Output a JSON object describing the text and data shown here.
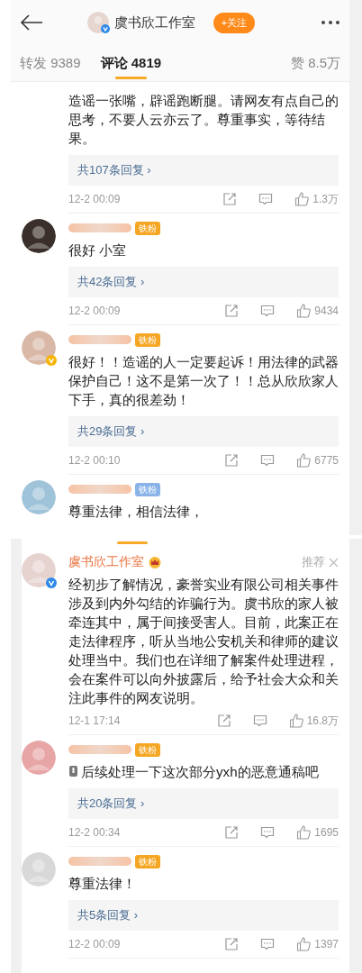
{
  "panels": [
    {
      "header": {
        "title": "虞书欣工作室",
        "follow": "+关注",
        "verified_badge": {
          "color": "#2d8ae8"
        }
      },
      "tabs": [
        {
          "label": "转发 9389",
          "selected": false
        },
        {
          "label": "评论 4819",
          "selected": true
        }
      ],
      "likes_total": "赞 8.5万",
      "comments": [
        {
          "cut_top": true,
          "text": "造谣一张嘴，辟谣跑断腿。请网友有点自己的思考，不要人云亦云了。尊重事实，等待结果。",
          "replies": "共107条回复 ›",
          "time": "12-2 00:09",
          "likes": "1.3万"
        },
        {
          "cut_top": false,
          "badge": {
            "label": "铁粉",
            "color": "#f5a623"
          },
          "text": "很好 小室",
          "replies": "共42条回复 ›",
          "time": "12-2 00:09",
          "likes": "9434"
        },
        {
          "cut_top": false,
          "badge": {
            "label": "铁粉",
            "color": "#f5a623"
          },
          "verified_badge": {
            "color": "#f5b400"
          },
          "text": "很好！！造谣的人一定要起诉！用法律的武器保护自己！这不是第一次了！！总从欣欣家人下手，真的很差劲！",
          "replies": "共29条回复 ›",
          "time": "12-2 00:10",
          "likes": "6775"
        },
        {
          "cut_top": false,
          "badge": {
            "label": "铁粉",
            "color": "#8ab4e8"
          },
          "text": "尊重法律，相信法律，"
        }
      ]
    },
    {
      "comments": [
        {
          "cut_top": false,
          "name": "虞书欣工作室",
          "crown": true,
          "verified_badge": {
            "color": "#2d8ae8"
          },
          "recommend": "推荐",
          "text": "经初步了解情况，豪誉实业有限公司相关事件涉及到内外勾结的诈骗行为。虞书欣的家人被牵连其中，属于间接受害人。目前，此案正在走法律程序，听从当地公安机关和律师的建议处理当中。我们也在详细了解案件处理进程，会在案件可以向外披露后，给予社会大众和关注此事件的网友说明。",
          "time": "12-1 17:14",
          "likes": "16.8万"
        },
        {
          "cut_top": false,
          "badge": {
            "label": "铁粉",
            "color": "#f5a623"
          },
          "emoji": true,
          "text": "后续处理一下这次部分yxh的恶意通稿吧",
          "replies": "共20条回复 ›",
          "time": "12-2 00:34",
          "likes": "1695"
        },
        {
          "cut_top": false,
          "badge": {
            "label": "铁粉",
            "color": "#f5a623"
          },
          "text": "尊重法律！",
          "replies": "共5条回复 ›",
          "time": "12-2 00:09",
          "likes": "1397"
        }
      ]
    }
  ]
}
